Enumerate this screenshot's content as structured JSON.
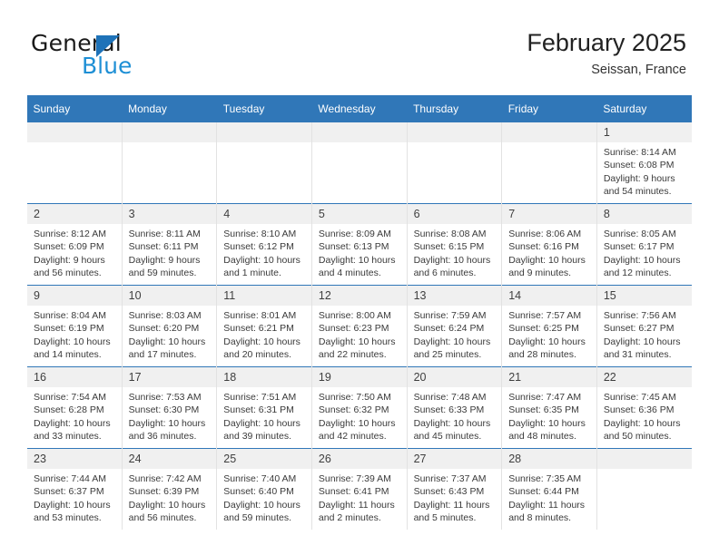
{
  "brand": {
    "name_top": "General",
    "name_bottom": "Blue",
    "accent_color": "#1e8fd5",
    "triangle_color": "#1e72b8"
  },
  "header": {
    "title": "February 2025",
    "location": "Seissan, France"
  },
  "calendar": {
    "header_bg": "#3077b8",
    "daynum_bg": "#f0f0f0",
    "weekday_headers": [
      "Sunday",
      "Monday",
      "Tuesday",
      "Wednesday",
      "Thursday",
      "Friday",
      "Saturday"
    ],
    "labels": {
      "sunrise": "Sunrise:",
      "sunset": "Sunset:",
      "daylight": "Daylight:"
    },
    "weeks": [
      [
        {
          "day": "",
          "blank": true
        },
        {
          "day": "",
          "blank": true
        },
        {
          "day": "",
          "blank": true
        },
        {
          "day": "",
          "blank": true
        },
        {
          "day": "",
          "blank": true
        },
        {
          "day": "",
          "blank": true
        },
        {
          "day": "1",
          "sunrise": "Sunrise: 8:14 AM",
          "sunset": "Sunset: 6:08 PM",
          "daylight": "Daylight: 9 hours and 54 minutes."
        }
      ],
      [
        {
          "day": "2",
          "sunrise": "Sunrise: 8:12 AM",
          "sunset": "Sunset: 6:09 PM",
          "daylight": "Daylight: 9 hours and 56 minutes."
        },
        {
          "day": "3",
          "sunrise": "Sunrise: 8:11 AM",
          "sunset": "Sunset: 6:11 PM",
          "daylight": "Daylight: 9 hours and 59 minutes."
        },
        {
          "day": "4",
          "sunrise": "Sunrise: 8:10 AM",
          "sunset": "Sunset: 6:12 PM",
          "daylight": "Daylight: 10 hours and 1 minute."
        },
        {
          "day": "5",
          "sunrise": "Sunrise: 8:09 AM",
          "sunset": "Sunset: 6:13 PM",
          "daylight": "Daylight: 10 hours and 4 minutes."
        },
        {
          "day": "6",
          "sunrise": "Sunrise: 8:08 AM",
          "sunset": "Sunset: 6:15 PM",
          "daylight": "Daylight: 10 hours and 6 minutes."
        },
        {
          "day": "7",
          "sunrise": "Sunrise: 8:06 AM",
          "sunset": "Sunset: 6:16 PM",
          "daylight": "Daylight: 10 hours and 9 minutes."
        },
        {
          "day": "8",
          "sunrise": "Sunrise: 8:05 AM",
          "sunset": "Sunset: 6:17 PM",
          "daylight": "Daylight: 10 hours and 12 minutes."
        }
      ],
      [
        {
          "day": "9",
          "sunrise": "Sunrise: 8:04 AM",
          "sunset": "Sunset: 6:19 PM",
          "daylight": "Daylight: 10 hours and 14 minutes."
        },
        {
          "day": "10",
          "sunrise": "Sunrise: 8:03 AM",
          "sunset": "Sunset: 6:20 PM",
          "daylight": "Daylight: 10 hours and 17 minutes."
        },
        {
          "day": "11",
          "sunrise": "Sunrise: 8:01 AM",
          "sunset": "Sunset: 6:21 PM",
          "daylight": "Daylight: 10 hours and 20 minutes."
        },
        {
          "day": "12",
          "sunrise": "Sunrise: 8:00 AM",
          "sunset": "Sunset: 6:23 PM",
          "daylight": "Daylight: 10 hours and 22 minutes."
        },
        {
          "day": "13",
          "sunrise": "Sunrise: 7:59 AM",
          "sunset": "Sunset: 6:24 PM",
          "daylight": "Daylight: 10 hours and 25 minutes."
        },
        {
          "day": "14",
          "sunrise": "Sunrise: 7:57 AM",
          "sunset": "Sunset: 6:25 PM",
          "daylight": "Daylight: 10 hours and 28 minutes."
        },
        {
          "day": "15",
          "sunrise": "Sunrise: 7:56 AM",
          "sunset": "Sunset: 6:27 PM",
          "daylight": "Daylight: 10 hours and 31 minutes."
        }
      ],
      [
        {
          "day": "16",
          "sunrise": "Sunrise: 7:54 AM",
          "sunset": "Sunset: 6:28 PM",
          "daylight": "Daylight: 10 hours and 33 minutes."
        },
        {
          "day": "17",
          "sunrise": "Sunrise: 7:53 AM",
          "sunset": "Sunset: 6:30 PM",
          "daylight": "Daylight: 10 hours and 36 minutes."
        },
        {
          "day": "18",
          "sunrise": "Sunrise: 7:51 AM",
          "sunset": "Sunset: 6:31 PM",
          "daylight": "Daylight: 10 hours and 39 minutes."
        },
        {
          "day": "19",
          "sunrise": "Sunrise: 7:50 AM",
          "sunset": "Sunset: 6:32 PM",
          "daylight": "Daylight: 10 hours and 42 minutes."
        },
        {
          "day": "20",
          "sunrise": "Sunrise: 7:48 AM",
          "sunset": "Sunset: 6:33 PM",
          "daylight": "Daylight: 10 hours and 45 minutes."
        },
        {
          "day": "21",
          "sunrise": "Sunrise: 7:47 AM",
          "sunset": "Sunset: 6:35 PM",
          "daylight": "Daylight: 10 hours and 48 minutes."
        },
        {
          "day": "22",
          "sunrise": "Sunrise: 7:45 AM",
          "sunset": "Sunset: 6:36 PM",
          "daylight": "Daylight: 10 hours and 50 minutes."
        }
      ],
      [
        {
          "day": "23",
          "sunrise": "Sunrise: 7:44 AM",
          "sunset": "Sunset: 6:37 PM",
          "daylight": "Daylight: 10 hours and 53 minutes."
        },
        {
          "day": "24",
          "sunrise": "Sunrise: 7:42 AM",
          "sunset": "Sunset: 6:39 PM",
          "daylight": "Daylight: 10 hours and 56 minutes."
        },
        {
          "day": "25",
          "sunrise": "Sunrise: 7:40 AM",
          "sunset": "Sunset: 6:40 PM",
          "daylight": "Daylight: 10 hours and 59 minutes."
        },
        {
          "day": "26",
          "sunrise": "Sunrise: 7:39 AM",
          "sunset": "Sunset: 6:41 PM",
          "daylight": "Daylight: 11 hours and 2 minutes."
        },
        {
          "day": "27",
          "sunrise": "Sunrise: 7:37 AM",
          "sunset": "Sunset: 6:43 PM",
          "daylight": "Daylight: 11 hours and 5 minutes."
        },
        {
          "day": "28",
          "sunrise": "Sunrise: 7:35 AM",
          "sunset": "Sunset: 6:44 PM",
          "daylight": "Daylight: 11 hours and 8 minutes."
        },
        {
          "day": "",
          "blank": true
        }
      ]
    ]
  }
}
